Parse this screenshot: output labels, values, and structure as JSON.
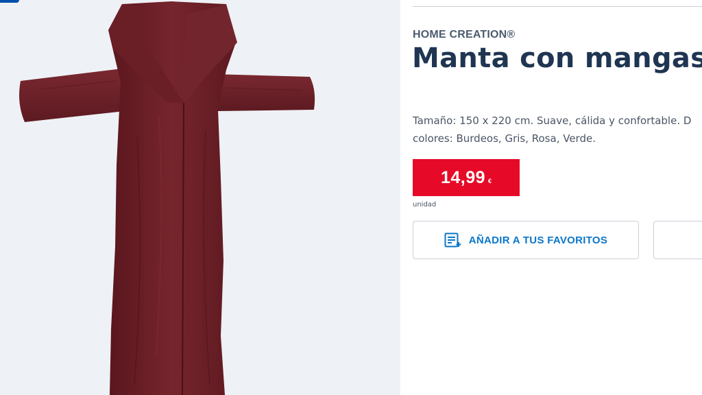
{
  "product": {
    "brand": "HOME CREATION®",
    "title": "Manta con mangas",
    "description_line1": "Tamaño: 150 x 220 cm. Suave, cálida y confortable. D",
    "description_line2": "colores: Burdeos, Gris, Rosa, Verde.",
    "price": "14,99",
    "currency": "€",
    "unit": "unidad",
    "image_icon": "sleeved-blanket-image",
    "color": "#6b1e26"
  },
  "actions": {
    "favorites_label": "AÑADIR A TUS FAVORITOS",
    "favorites_icon": "list-add-icon"
  },
  "colors": {
    "price_background": "#e60a28",
    "title": "#1f3552",
    "accent_link": "#0a76c9",
    "image_background": "#eef1f5"
  }
}
